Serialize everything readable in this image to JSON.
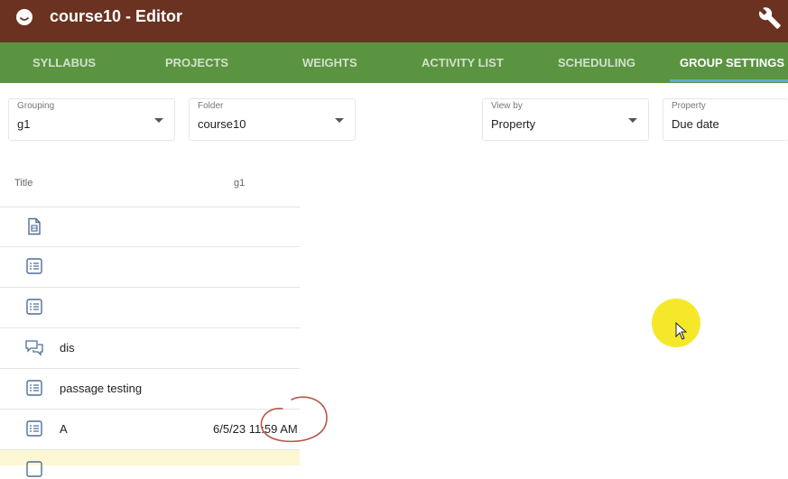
{
  "header": {
    "title": "course10 - Editor",
    "bg_color": "#6b3222"
  },
  "tabs": [
    {
      "label": "SYLLABUS"
    },
    {
      "label": "PROJECTS"
    },
    {
      "label": "WEIGHTS"
    },
    {
      "label": "ACTIVITY LIST"
    },
    {
      "label": "SCHEDULING"
    },
    {
      "label": "GROUP SETTINGS",
      "active": true
    }
  ],
  "tab_bar_color": "#5a9440",
  "filters": {
    "grouping": {
      "label": "Grouping",
      "value": "g1"
    },
    "folder": {
      "label": "Folder",
      "value": "course10"
    },
    "view_by": {
      "label": "View by",
      "value": "Property"
    },
    "property": {
      "label": "Property",
      "value": "Due date"
    }
  },
  "table": {
    "columns": [
      "Title",
      "g1"
    ],
    "rows": [
      {
        "icon": "document-icon",
        "title": "",
        "date": ""
      },
      {
        "icon": "checklist-icon",
        "title": "",
        "date": ""
      },
      {
        "icon": "checklist-icon",
        "title": "",
        "date": ""
      },
      {
        "icon": "discussion-icon",
        "title": "dis",
        "date": ""
      },
      {
        "icon": "checklist-icon",
        "title": "passage testing",
        "date": ""
      },
      {
        "icon": "checklist-icon",
        "title": "A",
        "date": "6/5/23 11:59 AM"
      },
      {
        "icon": "checklist-icon",
        "title": "",
        "date": "",
        "selected": true
      }
    ]
  },
  "highlight_color": "#f5e82b"
}
